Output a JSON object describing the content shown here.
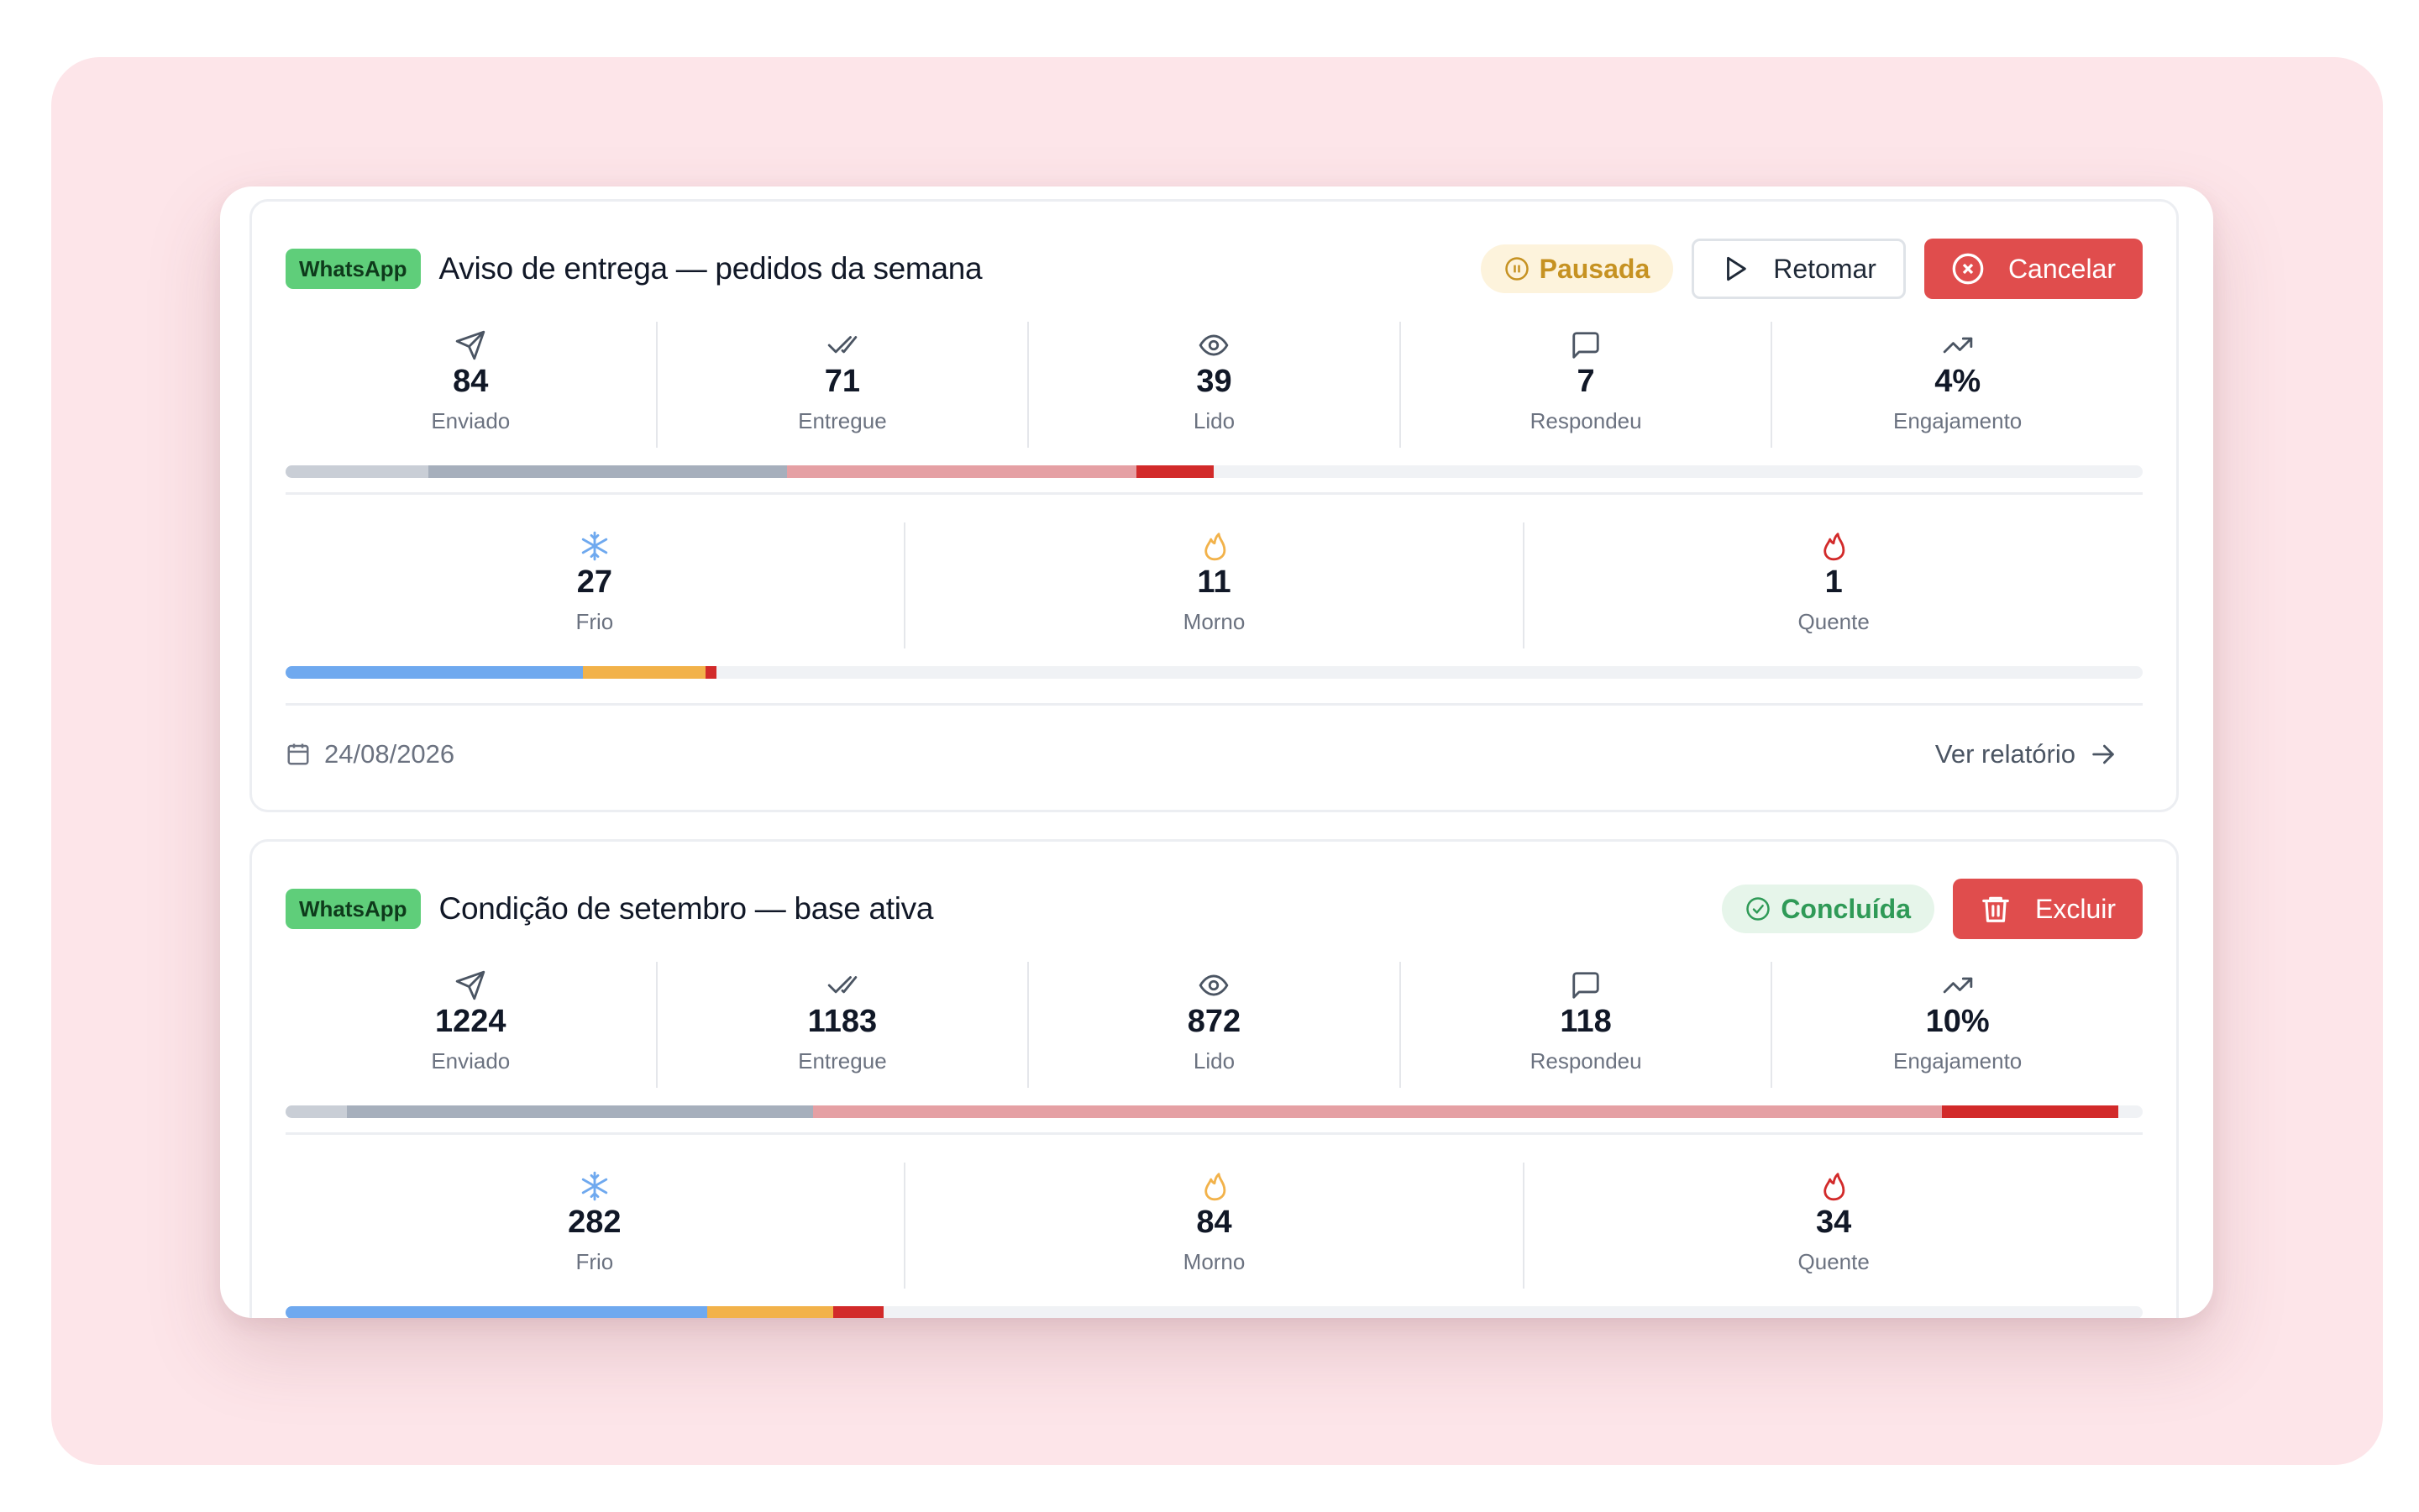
{
  "campaigns": [
    {
      "channel": "WhatsApp",
      "title": "Aviso de entrega — pedidos da semana",
      "status": "Pausada",
      "buttons": {
        "resume": "Retomar",
        "cancel": "Cancelar"
      },
      "stats": [
        {
          "value": "84",
          "label": "Enviado",
          "icon": "send-icon"
        },
        {
          "value": "71",
          "label": "Entregue",
          "icon": "double-check-icon"
        },
        {
          "value": "39",
          "label": "Lido",
          "icon": "eye-icon"
        },
        {
          "value": "7",
          "label": "Respondeu",
          "icon": "message-icon"
        },
        {
          "value": "4%",
          "label": "Engajamento",
          "icon": "trending-up-icon"
        }
      ],
      "temperature": [
        {
          "value": "27",
          "label": "Frio",
          "icon": "snowflake-icon"
        },
        {
          "value": "11",
          "label": "Morno",
          "icon": "flame-icon"
        },
        {
          "value": "1",
          "label": "Quente",
          "icon": "flame-icon"
        }
      ],
      "date": "24/08/2026",
      "report_link": "Ver relatório"
    },
    {
      "channel": "WhatsApp",
      "title": "Condição de setembro — base ativa",
      "status": "Concluída",
      "buttons": {
        "delete": "Excluir"
      },
      "stats": [
        {
          "value": "1224",
          "label": "Enviado",
          "icon": "send-icon"
        },
        {
          "value": "1183",
          "label": "Entregue",
          "icon": "double-check-icon"
        },
        {
          "value": "872",
          "label": "Lido",
          "icon": "eye-icon"
        },
        {
          "value": "118",
          "label": "Respondeu",
          "icon": "message-icon"
        },
        {
          "value": "10%",
          "label": "Engajamento",
          "icon": "trending-up-icon"
        }
      ],
      "temperature": [
        {
          "value": "282",
          "label": "Frio",
          "icon": "snowflake-icon"
        },
        {
          "value": "84",
          "label": "Morno",
          "icon": "flame-icon"
        },
        {
          "value": "34",
          "label": "Quente",
          "icon": "flame-icon"
        }
      ]
    }
  ],
  "colors": {
    "whatsapp": "#5fce7a",
    "paused": "#c69222",
    "done": "#2f9a57",
    "danger": "#e04d4d",
    "frio": "#6fa9ef",
    "morno": "#f2b24a",
    "quente": "#d22a2a",
    "funnel_1": "#c9ced6",
    "funnel_2": "#a6afbc",
    "funnel_3": "#e5a0a4",
    "funnel_4": "#d22a2a"
  }
}
